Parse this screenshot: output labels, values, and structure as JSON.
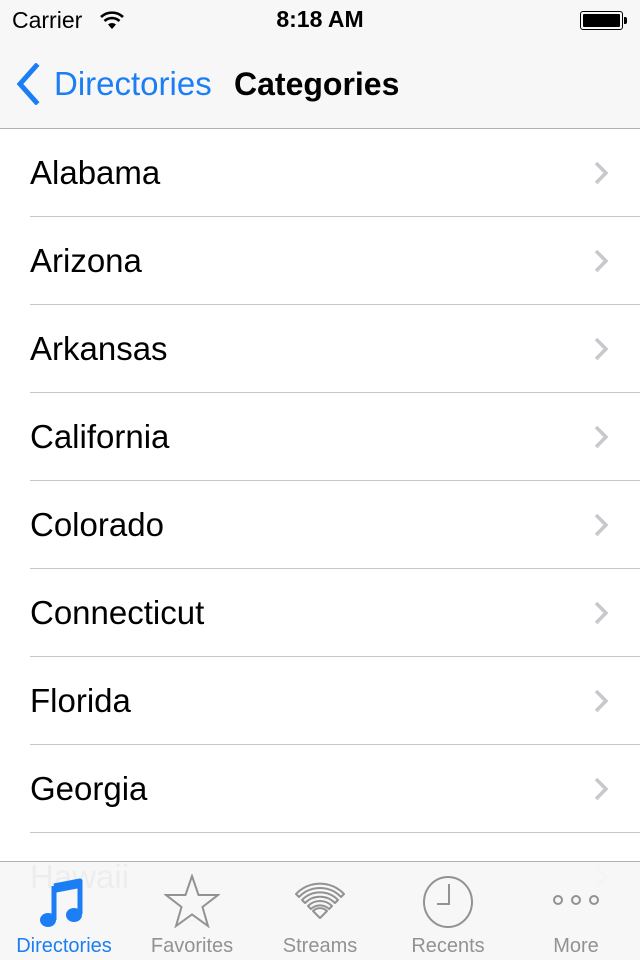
{
  "status_bar": {
    "carrier": "Carrier",
    "time": "8:18 AM",
    "battery_level": 1.0
  },
  "nav": {
    "back_label": "Directories",
    "title": "Categories"
  },
  "list": {
    "items": [
      {
        "label": "Alabama"
      },
      {
        "label": "Arizona"
      },
      {
        "label": "Arkansas"
      },
      {
        "label": "California"
      },
      {
        "label": "Colorado"
      },
      {
        "label": "Connecticut"
      },
      {
        "label": "Florida"
      },
      {
        "label": "Georgia"
      },
      {
        "label": "Hawaii"
      }
    ]
  },
  "tabbar": {
    "active_index": 0,
    "tabs": [
      {
        "label": "Directories",
        "icon": "music-note-icon"
      },
      {
        "label": "Favorites",
        "icon": "star-icon"
      },
      {
        "label": "Streams",
        "icon": "wifi-icon"
      },
      {
        "label": "Recents",
        "icon": "clock-icon"
      },
      {
        "label": "More",
        "icon": "more-dots-icon"
      }
    ]
  },
  "colors": {
    "accent": "#1b7ef5",
    "tab_inactive": "#929292",
    "chevron": "#c7c7cc",
    "bar_background": "#f7f7f7",
    "separator": "#c8c7cc"
  }
}
